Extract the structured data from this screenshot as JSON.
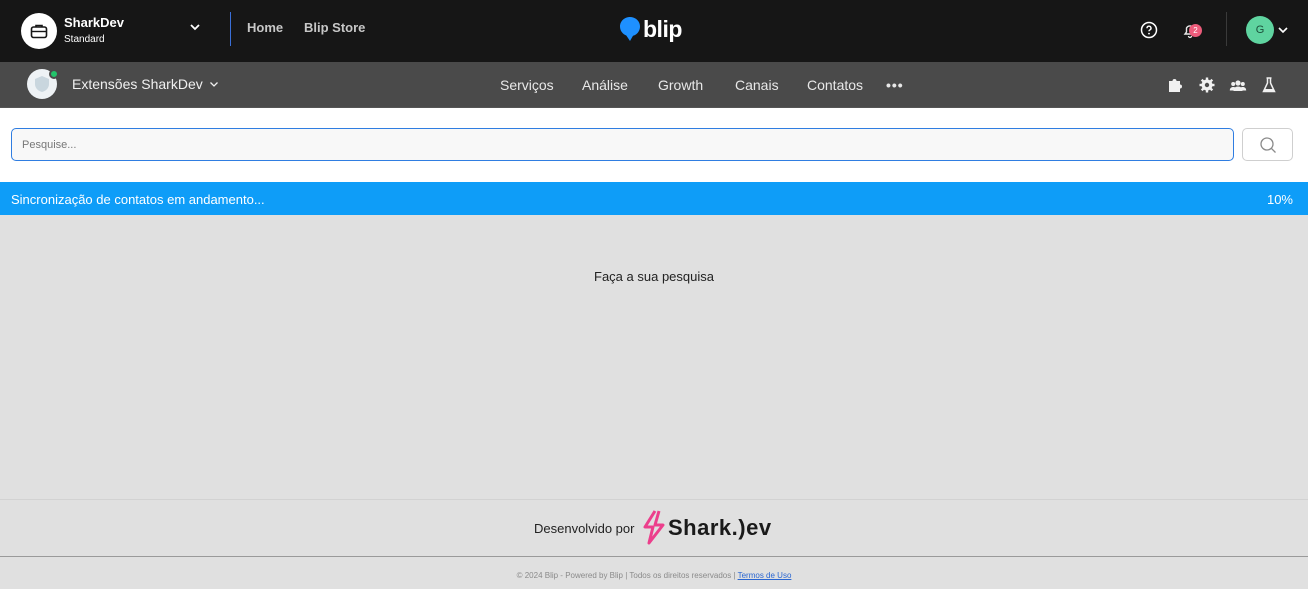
{
  "header": {
    "org_name": "SharkDev",
    "org_plan": "Standard",
    "nav": [
      "Home",
      "Blip Store"
    ],
    "logo_text": "blip",
    "notification_count": "2",
    "user_initial": "G",
    "brand_color": "#0e9df8"
  },
  "subheader": {
    "bot_name": "Extensões SharkDev",
    "menu": [
      "Serviços",
      "Análise",
      "Growth",
      "Canais",
      "Contatos"
    ],
    "more_label": "•••",
    "tool_icons": [
      "puzzle-icon",
      "gear-icon",
      "users-icon",
      "flask-icon"
    ]
  },
  "search": {
    "placeholder": "Pesquise...",
    "value": ""
  },
  "sync": {
    "label": "Sincronização de contatos em andamento...",
    "percent_label": "10%",
    "progress": 0.1
  },
  "main": {
    "empty_message": "Faça a sua pesquisa"
  },
  "footer": {
    "developed_by": "Desenvolvido por",
    "dev_logo_text": "Shark.)ev",
    "copyright": "© 2024 Blip - Powered by Blip | Todos os direitos reservados |",
    "terms_label": "Termos de Uso"
  }
}
